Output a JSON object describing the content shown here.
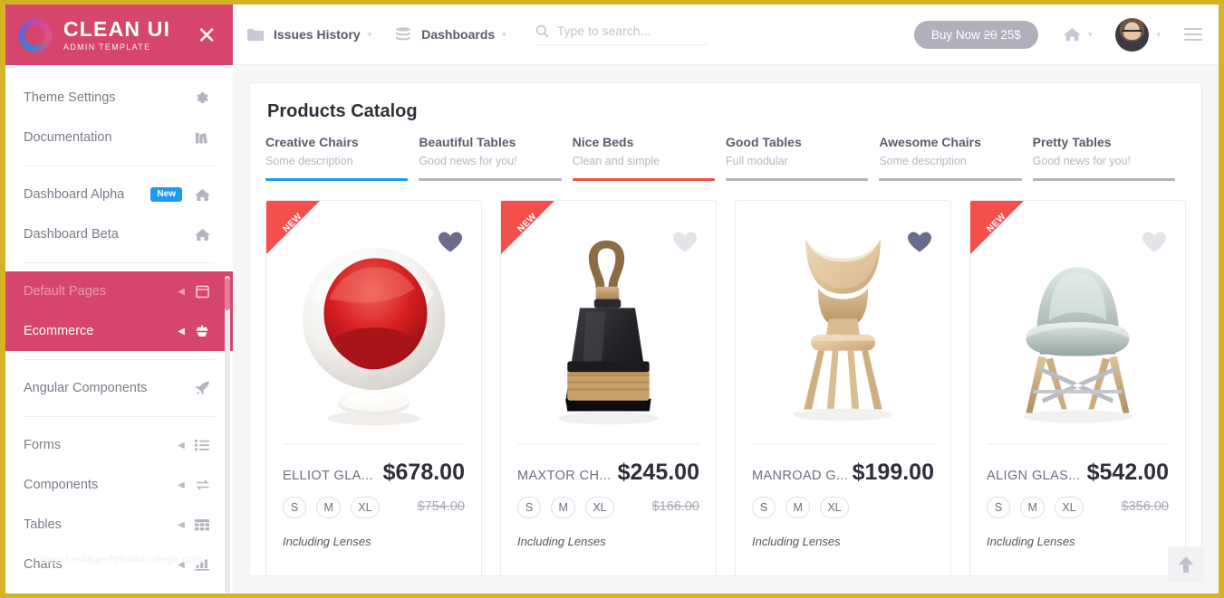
{
  "brand": {
    "title": "CLEAN UI",
    "subtitle": "ADMIN TEMPLATE",
    "close": "✕"
  },
  "sidebar": {
    "watermark": "www.heritagechristiancollege.com",
    "items": [
      {
        "label": "Theme Settings",
        "icon": "gear-icon",
        "badge": null,
        "caret": false
      },
      {
        "label": "Documentation",
        "icon": "book-icon",
        "badge": null,
        "caret": false
      },
      {
        "label": "Dashboard Alpha",
        "icon": "home-icon",
        "badge": "New",
        "caret": false
      },
      {
        "label": "Dashboard Beta",
        "icon": "home-icon",
        "badge": null,
        "caret": false
      },
      {
        "label": "Default Pages",
        "icon": "window-icon",
        "badge": null,
        "caret": true
      },
      {
        "label": "Ecommerce",
        "icon": "cart-icon",
        "badge": null,
        "caret": true
      },
      {
        "label": "Angular Components",
        "icon": "rocket-icon",
        "badge": null,
        "caret": false
      },
      {
        "label": "Forms",
        "icon": "list-icon",
        "badge": null,
        "caret": true
      },
      {
        "label": "Components",
        "icon": "swap-icon",
        "badge": null,
        "caret": true
      },
      {
        "label": "Tables",
        "icon": "table-icon",
        "badge": null,
        "caret": true
      },
      {
        "label": "Charts",
        "icon": "chart-icon",
        "badge": null,
        "caret": true
      }
    ]
  },
  "topbar": {
    "issues_label": "Issues History",
    "dashboards_label": "Dashboards",
    "search_placeholder": "Type to search...",
    "search_value": "",
    "buy_prefix": "Buy Now",
    "buy_old_price": "20",
    "buy_price": "25$",
    "caret": "▾"
  },
  "main": {
    "title": "Products Catalog",
    "tabs": [
      {
        "title": "Creative Chairs",
        "desc": "Some description",
        "color": "#1b9bf0"
      },
      {
        "title": "Beautiful Tables",
        "desc": "Good news for you!",
        "color": "#b3b3bb"
      },
      {
        "title": "Nice Beds",
        "desc": "Clean and simple",
        "color": "#f4504b"
      },
      {
        "title": "Good Tables",
        "desc": "Full modular",
        "color": "#b3b3bb"
      },
      {
        "title": "Awesome Chairs",
        "desc": "Some description",
        "color": "#b3b3bb"
      },
      {
        "title": "Pretty Tables",
        "desc": "Good news for you!",
        "color": "#b3b3bb"
      }
    ],
    "products": [
      {
        "name": "ELLIOT GLA...",
        "price": "$678.00",
        "old_price": "$754.00",
        "note": "Including Lenses",
        "sizes": [
          "S",
          "M",
          "XL"
        ],
        "ribbon": "NEW",
        "favorite": true,
        "image": "ball-chair-red"
      },
      {
        "name": "MAXTOR CH...",
        "price": "$245.00",
        "old_price": "$166.00",
        "note": "Including Lenses",
        "sizes": [
          "S",
          "M",
          "XL"
        ],
        "ribbon": "NEW",
        "favorite": false,
        "image": "dustpan-brush"
      },
      {
        "name": "MANROAD G...",
        "price": "$199.00",
        "old_price": null,
        "note": "Including Lenses",
        "sizes": [
          "S",
          "M",
          "XL"
        ],
        "ribbon": null,
        "favorite": true,
        "image": "wood-chair"
      },
      {
        "name": "ALIGN GLAS...",
        "price": "$542.00",
        "old_price": "$356.00",
        "note": "Including Lenses",
        "sizes": [
          "S",
          "M",
          "XL"
        ],
        "ribbon": "NEW",
        "favorite": false,
        "image": "eames-chair"
      }
    ],
    "scroll_top": "⬆"
  },
  "colors": {
    "brand_pink": "#d6456b",
    "accent_blue": "#1b9bf0",
    "accent_red": "#f4504b",
    "frame_gold": "#d4b326"
  }
}
